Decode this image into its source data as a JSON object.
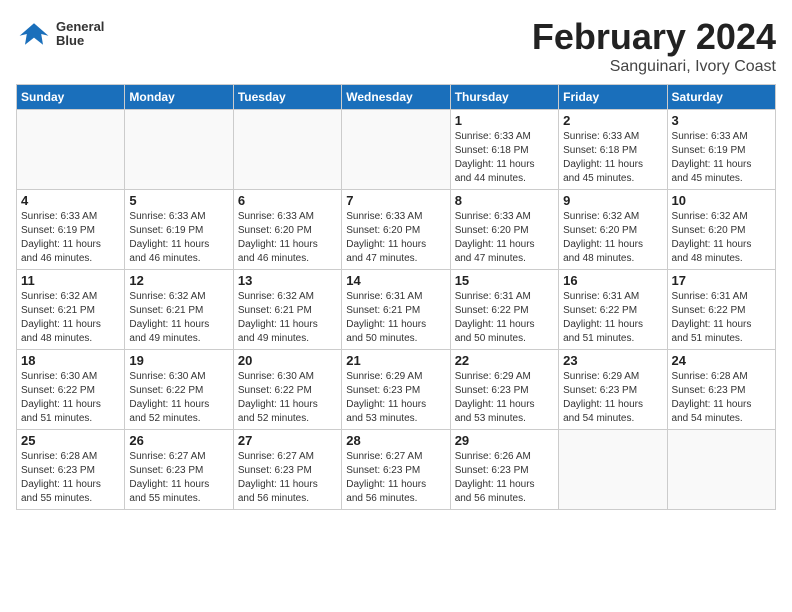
{
  "header": {
    "logo_line1": "General",
    "logo_line2": "Blue",
    "month": "February 2024",
    "location": "Sanguinari, Ivory Coast"
  },
  "weekdays": [
    "Sunday",
    "Monday",
    "Tuesday",
    "Wednesday",
    "Thursday",
    "Friday",
    "Saturday"
  ],
  "weeks": [
    [
      {
        "day": "",
        "info": ""
      },
      {
        "day": "",
        "info": ""
      },
      {
        "day": "",
        "info": ""
      },
      {
        "day": "",
        "info": ""
      },
      {
        "day": "1",
        "info": "Sunrise: 6:33 AM\nSunset: 6:18 PM\nDaylight: 11 hours\nand 44 minutes."
      },
      {
        "day": "2",
        "info": "Sunrise: 6:33 AM\nSunset: 6:18 PM\nDaylight: 11 hours\nand 45 minutes."
      },
      {
        "day": "3",
        "info": "Sunrise: 6:33 AM\nSunset: 6:19 PM\nDaylight: 11 hours\nand 45 minutes."
      }
    ],
    [
      {
        "day": "4",
        "info": "Sunrise: 6:33 AM\nSunset: 6:19 PM\nDaylight: 11 hours\nand 46 minutes."
      },
      {
        "day": "5",
        "info": "Sunrise: 6:33 AM\nSunset: 6:19 PM\nDaylight: 11 hours\nand 46 minutes."
      },
      {
        "day": "6",
        "info": "Sunrise: 6:33 AM\nSunset: 6:20 PM\nDaylight: 11 hours\nand 46 minutes."
      },
      {
        "day": "7",
        "info": "Sunrise: 6:33 AM\nSunset: 6:20 PM\nDaylight: 11 hours\nand 47 minutes."
      },
      {
        "day": "8",
        "info": "Sunrise: 6:33 AM\nSunset: 6:20 PM\nDaylight: 11 hours\nand 47 minutes."
      },
      {
        "day": "9",
        "info": "Sunrise: 6:32 AM\nSunset: 6:20 PM\nDaylight: 11 hours\nand 48 minutes."
      },
      {
        "day": "10",
        "info": "Sunrise: 6:32 AM\nSunset: 6:20 PM\nDaylight: 11 hours\nand 48 minutes."
      }
    ],
    [
      {
        "day": "11",
        "info": "Sunrise: 6:32 AM\nSunset: 6:21 PM\nDaylight: 11 hours\nand 48 minutes."
      },
      {
        "day": "12",
        "info": "Sunrise: 6:32 AM\nSunset: 6:21 PM\nDaylight: 11 hours\nand 49 minutes."
      },
      {
        "day": "13",
        "info": "Sunrise: 6:32 AM\nSunset: 6:21 PM\nDaylight: 11 hours\nand 49 minutes."
      },
      {
        "day": "14",
        "info": "Sunrise: 6:31 AM\nSunset: 6:21 PM\nDaylight: 11 hours\nand 50 minutes."
      },
      {
        "day": "15",
        "info": "Sunrise: 6:31 AM\nSunset: 6:22 PM\nDaylight: 11 hours\nand 50 minutes."
      },
      {
        "day": "16",
        "info": "Sunrise: 6:31 AM\nSunset: 6:22 PM\nDaylight: 11 hours\nand 51 minutes."
      },
      {
        "day": "17",
        "info": "Sunrise: 6:31 AM\nSunset: 6:22 PM\nDaylight: 11 hours\nand 51 minutes."
      }
    ],
    [
      {
        "day": "18",
        "info": "Sunrise: 6:30 AM\nSunset: 6:22 PM\nDaylight: 11 hours\nand 51 minutes."
      },
      {
        "day": "19",
        "info": "Sunrise: 6:30 AM\nSunset: 6:22 PM\nDaylight: 11 hours\nand 52 minutes."
      },
      {
        "day": "20",
        "info": "Sunrise: 6:30 AM\nSunset: 6:22 PM\nDaylight: 11 hours\nand 52 minutes."
      },
      {
        "day": "21",
        "info": "Sunrise: 6:29 AM\nSunset: 6:23 PM\nDaylight: 11 hours\nand 53 minutes."
      },
      {
        "day": "22",
        "info": "Sunrise: 6:29 AM\nSunset: 6:23 PM\nDaylight: 11 hours\nand 53 minutes."
      },
      {
        "day": "23",
        "info": "Sunrise: 6:29 AM\nSunset: 6:23 PM\nDaylight: 11 hours\nand 54 minutes."
      },
      {
        "day": "24",
        "info": "Sunrise: 6:28 AM\nSunset: 6:23 PM\nDaylight: 11 hours\nand 54 minutes."
      }
    ],
    [
      {
        "day": "25",
        "info": "Sunrise: 6:28 AM\nSunset: 6:23 PM\nDaylight: 11 hours\nand 55 minutes."
      },
      {
        "day": "26",
        "info": "Sunrise: 6:27 AM\nSunset: 6:23 PM\nDaylight: 11 hours\nand 55 minutes."
      },
      {
        "day": "27",
        "info": "Sunrise: 6:27 AM\nSunset: 6:23 PM\nDaylight: 11 hours\nand 56 minutes."
      },
      {
        "day": "28",
        "info": "Sunrise: 6:27 AM\nSunset: 6:23 PM\nDaylight: 11 hours\nand 56 minutes."
      },
      {
        "day": "29",
        "info": "Sunrise: 6:26 AM\nSunset: 6:23 PM\nDaylight: 11 hours\nand 56 minutes."
      },
      {
        "day": "",
        "info": ""
      },
      {
        "day": "",
        "info": ""
      }
    ]
  ]
}
